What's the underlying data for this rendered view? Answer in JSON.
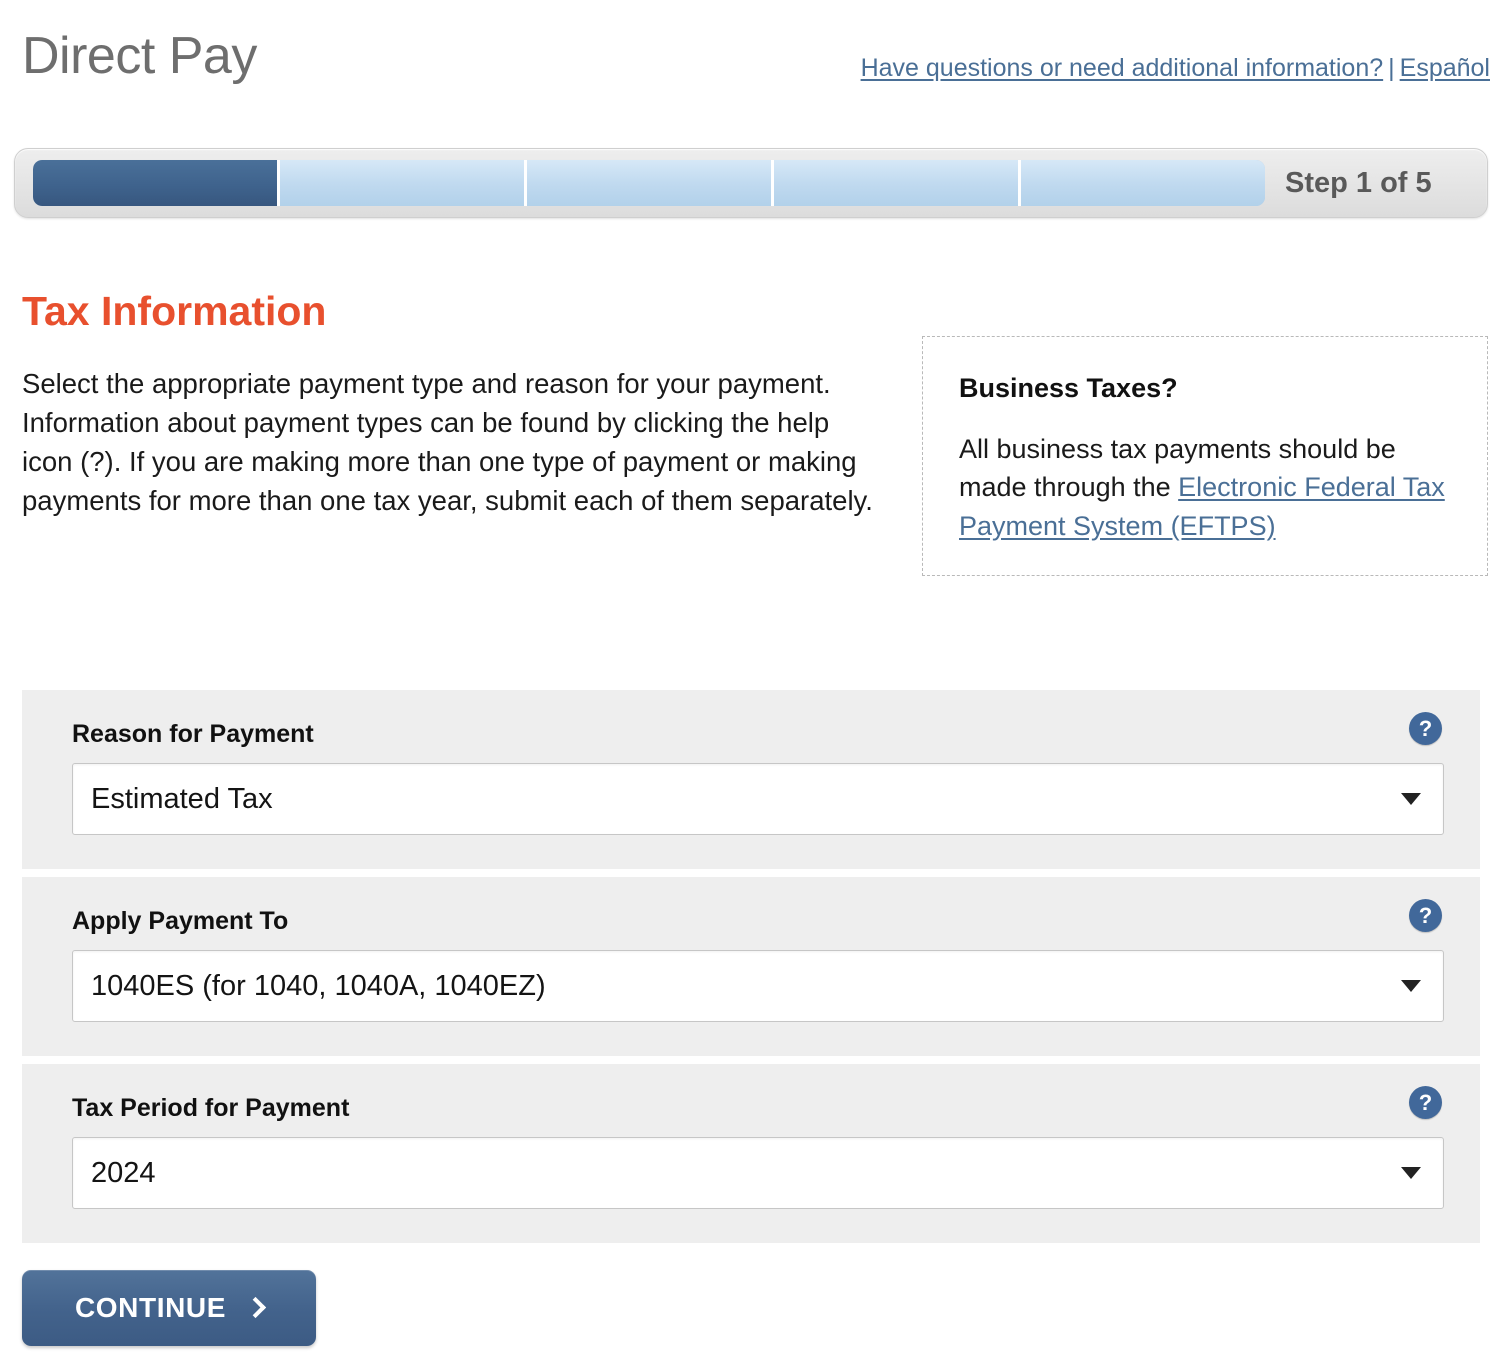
{
  "header": {
    "brand": "Direct Pay",
    "help_link": "Have questions or need additional information?",
    "separator": "|",
    "language_link": "Español"
  },
  "progress": {
    "label": "Step 1 of 5",
    "total_steps": 5,
    "current_step": 1,
    "filled_color": "#3f638d",
    "empty_color": "#bfd9ef"
  },
  "section": {
    "title": "Tax Information",
    "title_color": "#e8502e",
    "intro": "Select the appropriate payment type and reason for your payment. Information about payment types can be found by clicking the help icon (?). If you are making more than one type of payment or making payments for more than one tax year, submit each of them separately."
  },
  "business_box": {
    "title": "Business Taxes?",
    "text_before": "All business tax payments should be made through the ",
    "link": "Electronic Federal Tax Payment System (EFTPS)"
  },
  "fields": [
    {
      "label": "Reason for Payment",
      "value": "Estimated Tax",
      "help": "?"
    },
    {
      "label": "Apply Payment To",
      "value": "1040ES (for 1040, 1040A, 1040EZ)",
      "help": "?"
    },
    {
      "label": "Tax Period for Payment",
      "value": "2024",
      "help": "?"
    }
  ],
  "actions": {
    "continue_label": "CONTINUE"
  }
}
